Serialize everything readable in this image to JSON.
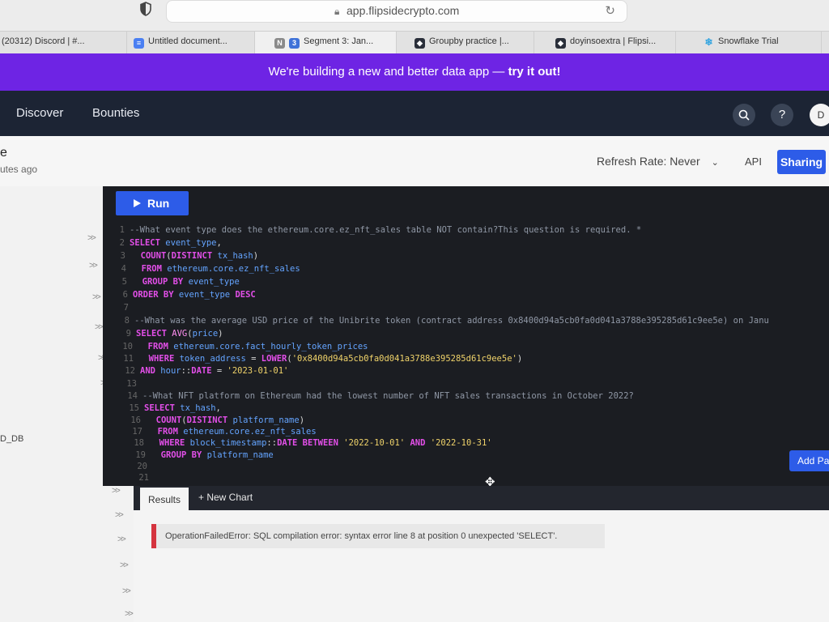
{
  "browser": {
    "url": "app.flipsidecrypto.com",
    "tabs": [
      {
        "label": "(20312) Discord | #...",
        "icon": "discord-icon"
      },
      {
        "label": "Untitled document...",
        "icon": "docs-icon"
      },
      {
        "label": "Segment 3: Jan...",
        "icon": "notion-icon",
        "prefix": "N",
        "badge": "3"
      },
      {
        "label": "Groupby practice |...",
        "icon": "flipside-icon"
      },
      {
        "label": "doyinsoextra | Flipsi...",
        "icon": "flipside-icon"
      },
      {
        "label": "Snowflake Trial",
        "icon": "snowflake-icon"
      }
    ]
  },
  "banner": {
    "text": "We're building a new and better data app — ",
    "cta": "try it out!"
  },
  "nav": {
    "links": [
      "Discover",
      "Bounties"
    ],
    "help": "?",
    "avatar": "D"
  },
  "query_header": {
    "title_fragment": "e",
    "updated_fragment": "utes ago",
    "refresh_label": "Refresh Rate: Never",
    "api_label": "API",
    "sharing_label": "Sharing"
  },
  "sidebar": {
    "db_label": "D_DB",
    "collapse_glyph": ">>"
  },
  "editor": {
    "run_label": "Run",
    "add_panel_label": "Add Pa"
  },
  "code_lines": [
    {
      "n": "1",
      "parts": [
        {
          "c": "cm",
          "t": "--What event type does the ethereum.core.ez_nft_sales table NOT contain?This question is required. *"
        }
      ]
    },
    {
      "n": "2",
      "parts": [
        {
          "c": "kw",
          "t": "SELECT"
        },
        {
          "c": "",
          "t": " "
        },
        {
          "c": "id",
          "t": "event_type"
        },
        {
          "c": "",
          "t": ","
        }
      ]
    },
    {
      "n": "3",
      "parts": [
        {
          "c": "",
          "t": "  "
        },
        {
          "c": "kw",
          "t": "COUNT"
        },
        {
          "c": "",
          "t": "("
        },
        {
          "c": "kw",
          "t": "DISTINCT"
        },
        {
          "c": "",
          "t": " "
        },
        {
          "c": "id",
          "t": "tx_hash"
        },
        {
          "c": "",
          "t": ")"
        }
      ]
    },
    {
      "n": "4",
      "parts": [
        {
          "c": "",
          "t": "  "
        },
        {
          "c": "kw",
          "t": "FROM"
        },
        {
          "c": "",
          "t": " "
        },
        {
          "c": "id",
          "t": "ethereum.core.ez_nft_sales"
        }
      ]
    },
    {
      "n": "5",
      "parts": [
        {
          "c": "",
          "t": "  "
        },
        {
          "c": "kw",
          "t": "GROUP BY"
        },
        {
          "c": "",
          "t": " "
        },
        {
          "c": "id",
          "t": "event_type"
        }
      ]
    },
    {
      "n": "6",
      "parts": [
        {
          "c": "kw",
          "t": "ORDER BY"
        },
        {
          "c": "",
          "t": " "
        },
        {
          "c": "id",
          "t": "event_type"
        },
        {
          "c": "",
          "t": " "
        },
        {
          "c": "kw",
          "t": "DESC"
        }
      ]
    },
    {
      "n": "7",
      "parts": []
    },
    {
      "n": "8",
      "parts": [
        {
          "c": "cm",
          "t": "--What was the average USD price of the Unibrite token (contract address 0x8400d94a5cb0fa0d041a3788e395285d61c9ee5e) on Janu"
        }
      ]
    },
    {
      "n": "9",
      "parts": [
        {
          "c": "kw",
          "t": "SELECT"
        },
        {
          "c": "",
          "t": " "
        },
        {
          "c": "fn",
          "t": "AVG"
        },
        {
          "c": "",
          "t": "("
        },
        {
          "c": "id",
          "t": "price"
        },
        {
          "c": "",
          "t": ")"
        }
      ]
    },
    {
      "n": "10",
      "parts": [
        {
          "c": "",
          "t": "  "
        },
        {
          "c": "kw",
          "t": "FROM"
        },
        {
          "c": "",
          "t": " "
        },
        {
          "c": "id",
          "t": "ethereum.core.fact_hourly_token_prices"
        }
      ]
    },
    {
      "n": "11",
      "parts": [
        {
          "c": "",
          "t": "  "
        },
        {
          "c": "kw",
          "t": "WHERE"
        },
        {
          "c": "",
          "t": " "
        },
        {
          "c": "id",
          "t": "token_address"
        },
        {
          "c": "",
          "t": " = "
        },
        {
          "c": "kw",
          "t": "LOWER"
        },
        {
          "c": "",
          "t": "("
        },
        {
          "c": "str",
          "t": "'0x8400d94a5cb0fa0d041a3788e395285d61c9ee5e'"
        },
        {
          "c": "",
          "t": ")"
        }
      ]
    },
    {
      "n": "12",
      "parts": [
        {
          "c": "kw",
          "t": "AND"
        },
        {
          "c": "",
          "t": " "
        },
        {
          "c": "id",
          "t": "hour"
        },
        {
          "c": "",
          "t": "::"
        },
        {
          "c": "kw",
          "t": "DATE"
        },
        {
          "c": "",
          "t": " = "
        },
        {
          "c": "str",
          "t": "'2023-01-01'"
        }
      ]
    },
    {
      "n": "13",
      "parts": []
    },
    {
      "n": "14",
      "parts": [
        {
          "c": "cm",
          "t": "--What NFT platform on Ethereum had the lowest number of NFT sales transactions in October 2022?"
        }
      ]
    },
    {
      "n": "15",
      "parts": [
        {
          "c": "kw",
          "t": "SELECT"
        },
        {
          "c": "",
          "t": " "
        },
        {
          "c": "id",
          "t": "tx_hash"
        },
        {
          "c": "",
          "t": ","
        }
      ]
    },
    {
      "n": "16",
      "parts": [
        {
          "c": "",
          "t": "  "
        },
        {
          "c": "kw",
          "t": "COUNT"
        },
        {
          "c": "",
          "t": "("
        },
        {
          "c": "kw",
          "t": "DISTINCT"
        },
        {
          "c": "",
          "t": " "
        },
        {
          "c": "id",
          "t": "platform_name"
        },
        {
          "c": "",
          "t": ")"
        }
      ]
    },
    {
      "n": "17",
      "parts": [
        {
          "c": "",
          "t": "  "
        },
        {
          "c": "kw",
          "t": "FROM"
        },
        {
          "c": "",
          "t": " "
        },
        {
          "c": "id",
          "t": "ethereum.core.ez_nft_sales"
        }
      ]
    },
    {
      "n": "18",
      "parts": [
        {
          "c": "",
          "t": "  "
        },
        {
          "c": "kw",
          "t": "WHERE"
        },
        {
          "c": "",
          "t": " "
        },
        {
          "c": "id",
          "t": "block_timestamp"
        },
        {
          "c": "",
          "t": "::"
        },
        {
          "c": "kw",
          "t": "DATE BETWEEN"
        },
        {
          "c": "",
          "t": " "
        },
        {
          "c": "str",
          "t": "'2022-10-01'"
        },
        {
          "c": "",
          "t": " "
        },
        {
          "c": "kw",
          "t": "AND"
        },
        {
          "c": "",
          "t": " "
        },
        {
          "c": "str",
          "t": "'2022-10-31'"
        }
      ]
    },
    {
      "n": "19",
      "parts": [
        {
          "c": "",
          "t": "  "
        },
        {
          "c": "kw",
          "t": "GROUP BY"
        },
        {
          "c": "",
          "t": " "
        },
        {
          "c": "id",
          "t": "platform_name"
        }
      ]
    },
    {
      "n": "20",
      "parts": []
    },
    {
      "n": "21",
      "parts": []
    }
  ],
  "results": {
    "tab_label": "Results",
    "new_chart_label": "+ New Chart",
    "error_text": "OperationFailedError: SQL compilation error: syntax error line 8 at position 0 unexpected 'SELECT'."
  },
  "colors": {
    "banner": "#6e24e4",
    "nav": "#1c2434",
    "primary_button": "#2d5ce8",
    "editor_bg": "#1b1d22",
    "error_accent": "#d5343f"
  }
}
